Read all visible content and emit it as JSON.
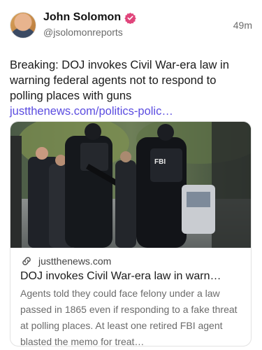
{
  "post": {
    "author": {
      "display_name": "John Solomon",
      "handle": "@jsolomonreports",
      "verified_icon": "verified-badge-icon",
      "avatar": "avatar"
    },
    "timestamp": "49m",
    "text": "Breaking: DOJ invokes Civil War-era law in warning federal agents not to respond to polling places with guns ",
    "link_text": "justthenews.com/politics-polic…"
  },
  "link_card": {
    "image": "fbi-agents-photo",
    "domain": "justthenews.com",
    "title": "DOJ invokes Civil War-era law in warn…",
    "description": "Agents told they could face felony under a law passed in 1865 even if responding to a fake threat at polling places. At least one retired FBI agent blasted the memo for treat…",
    "image_text": "FBI",
    "link_icon": "link-icon"
  },
  "colors": {
    "accent_link": "#5b4ce0",
    "verified": "#e0457b",
    "muted_text": "#6b6b6b"
  }
}
